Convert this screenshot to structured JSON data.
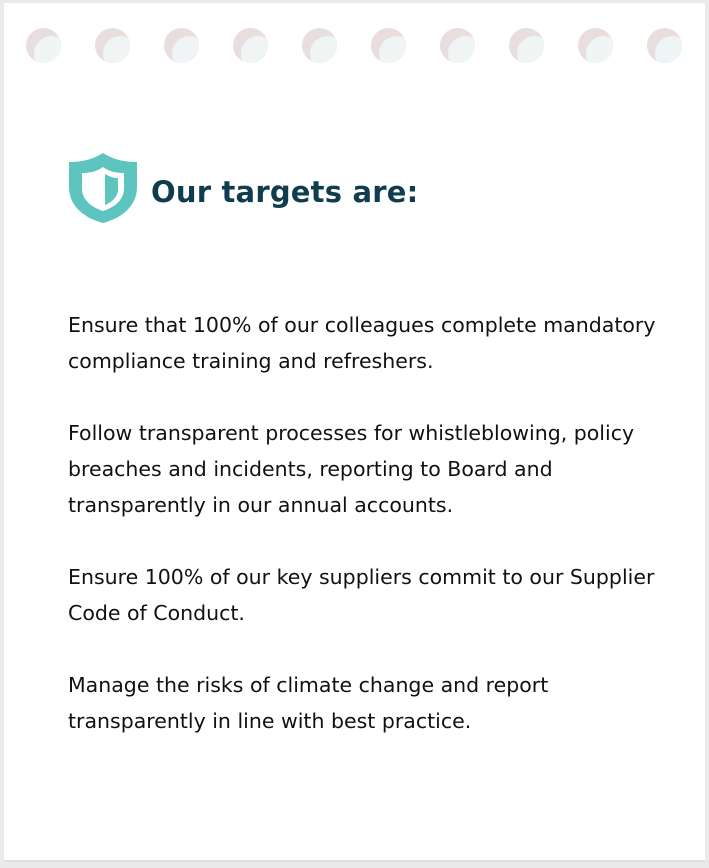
{
  "header": {
    "title": "Our targets are:",
    "icon": "shield-icon"
  },
  "colors": {
    "title": "#0f3c4e",
    "icon": "#5ec4c0",
    "text": "#111111",
    "hole": "#e8dedd"
  },
  "targets": [
    "Ensure that 100% of our colleagues complete mandatory compliance training and refreshers.",
    "Follow transparent processes for whistleblowing, policy breaches and incidents, reporting to Board and transparently in our annual accounts.",
    "Ensure 100% of our key suppliers commit to our Supplier Code of Conduct.",
    "Manage the risks of climate change and report transparently in line with best practice."
  ]
}
